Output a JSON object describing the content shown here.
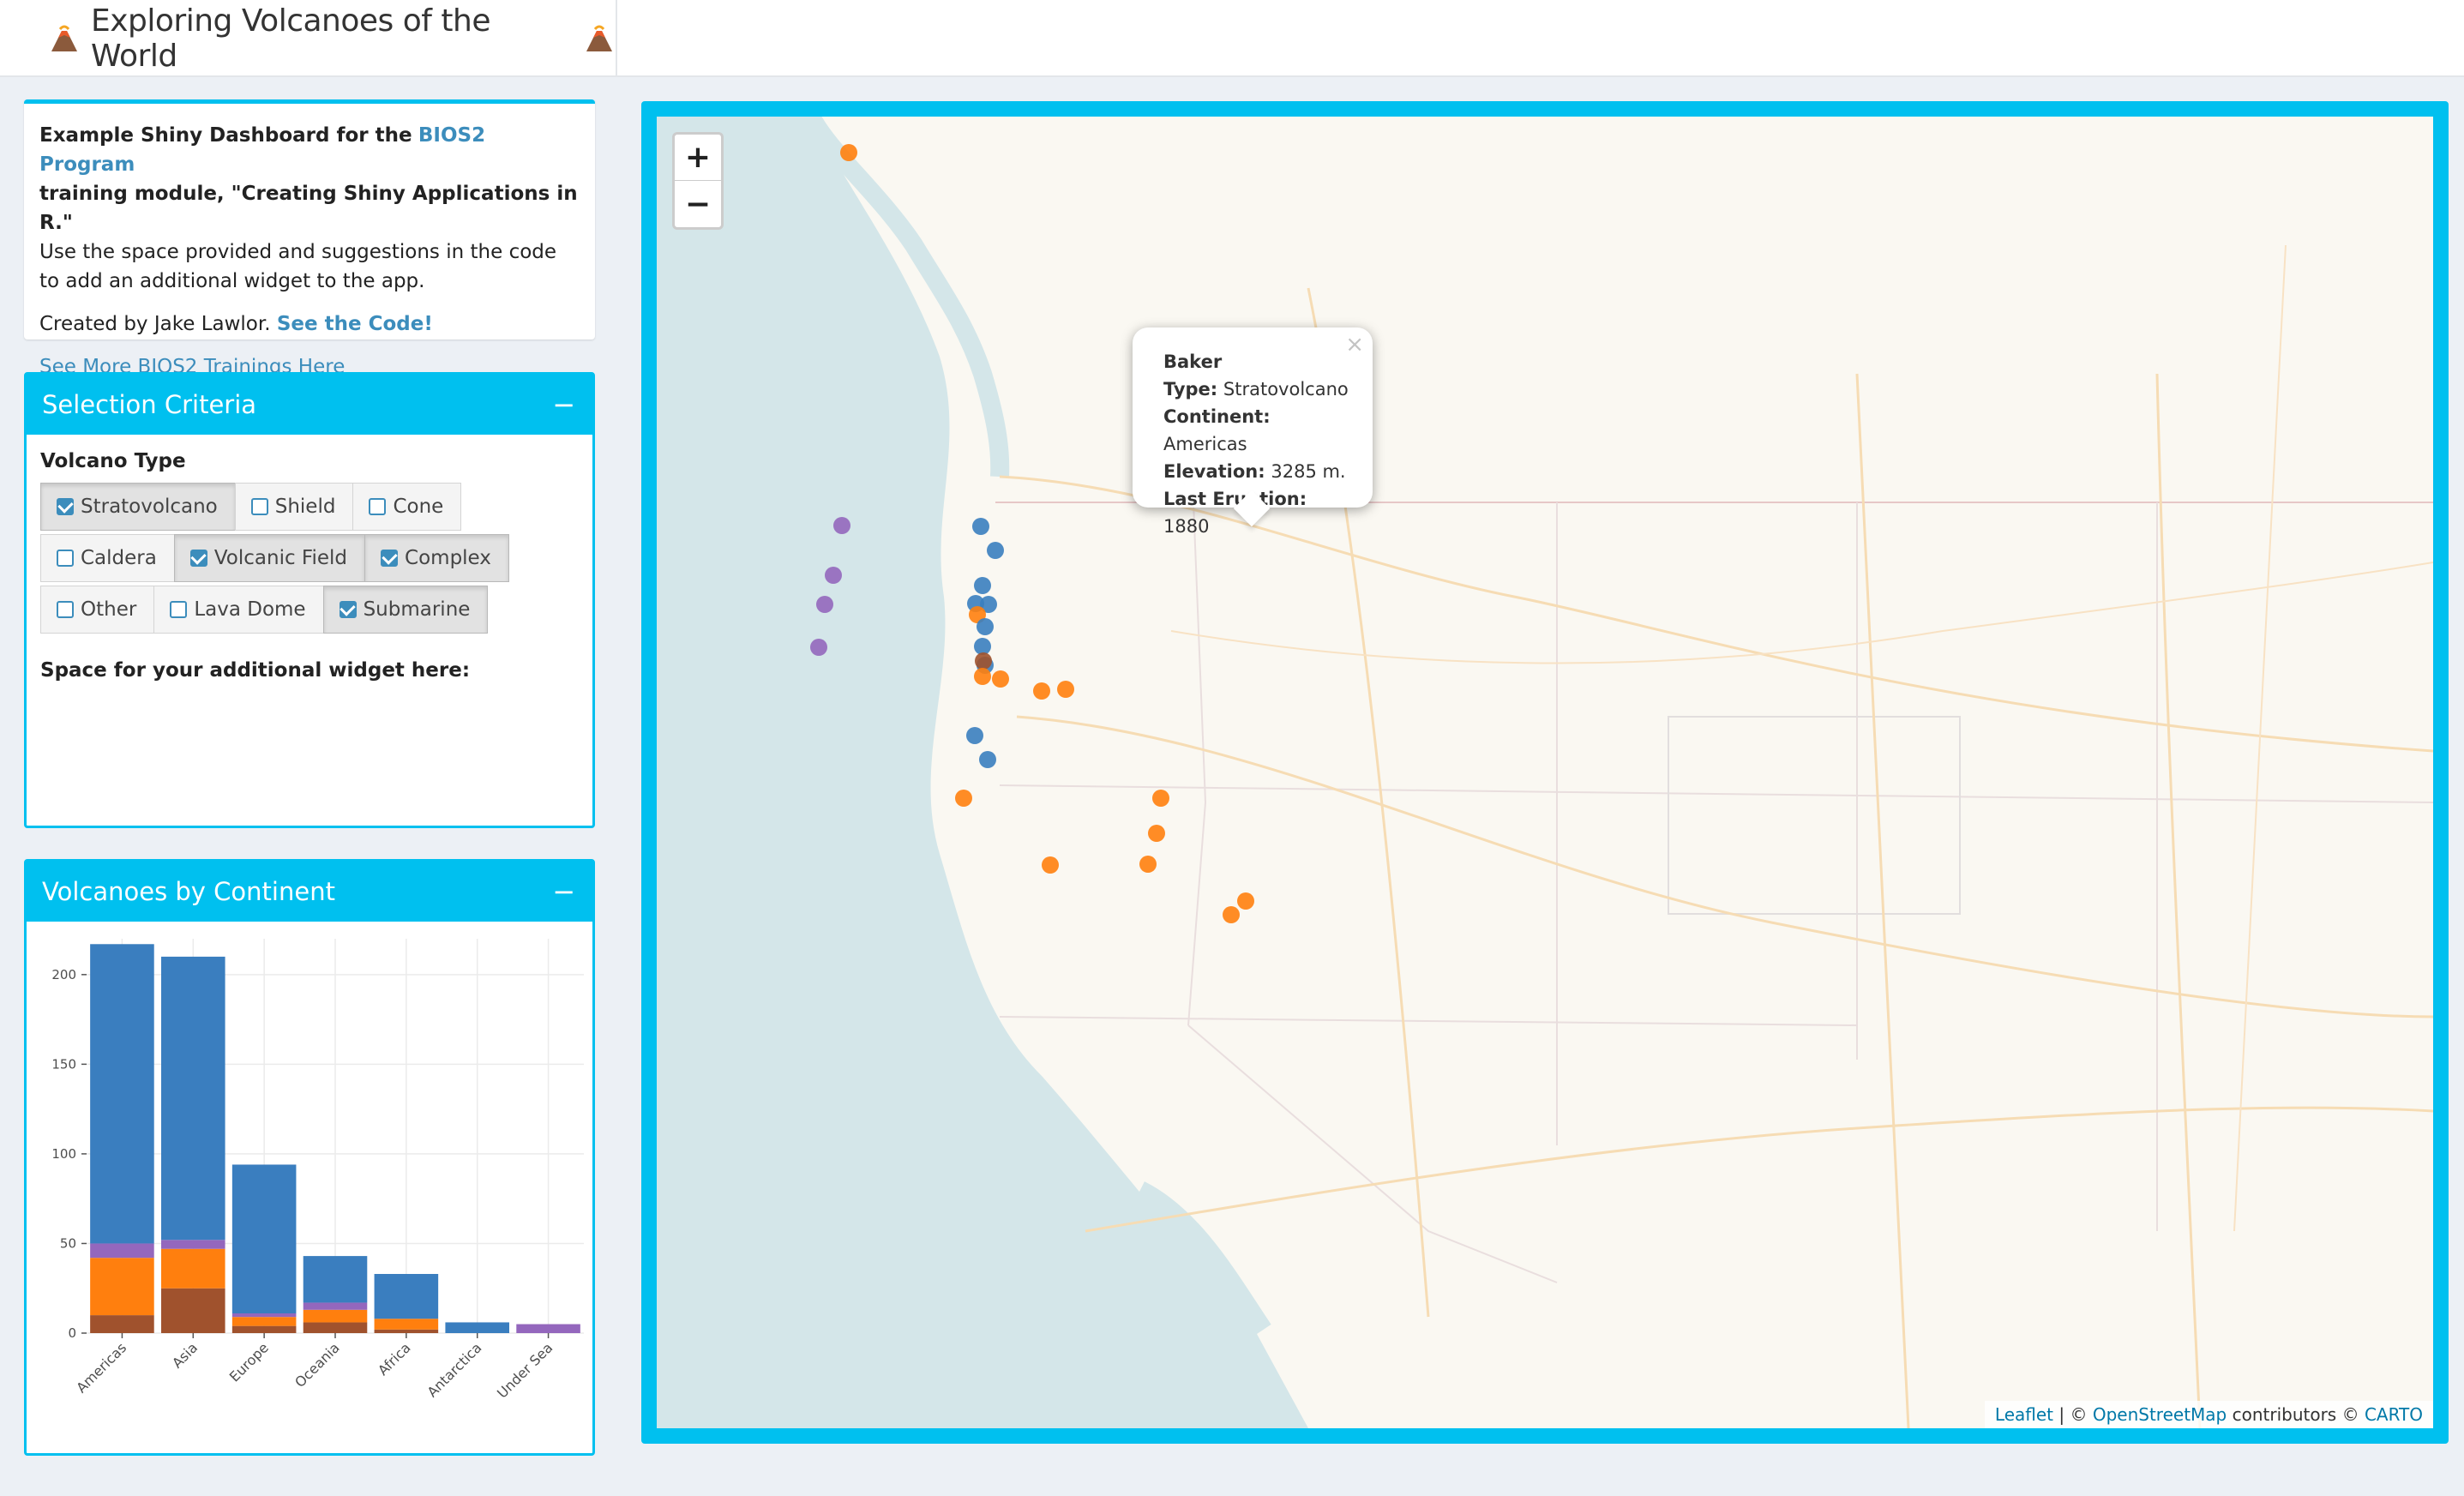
{
  "header": {
    "title": "Exploring Volcanoes of the World"
  },
  "info": {
    "intro_bold_1": "Example Shiny Dashboard for the",
    "intro_link": "BIOS2 Program",
    "intro_bold_2": "training module, \"Creating Shiny Applications in R.\"",
    "intro_text": "Use the space provided and suggestions in the code to add an additional widget to the app.",
    "created_by": "Created by Jake Lawlor.",
    "code_link": "See the Code!",
    "more_link": "See More BIOS2 Trainings Here"
  },
  "selection": {
    "title": "Selection Criteria",
    "collapse": "−",
    "type_label": "Volcano Type",
    "options": [
      {
        "label": "Stratovolcano",
        "checked": true
      },
      {
        "label": "Shield",
        "checked": false
      },
      {
        "label": "Cone",
        "checked": false
      },
      {
        "label": "Caldera",
        "checked": false
      },
      {
        "label": "Volcanic Field",
        "checked": true
      },
      {
        "label": "Complex",
        "checked": true
      },
      {
        "label": "Other",
        "checked": false
      },
      {
        "label": "Lava Dome",
        "checked": false
      },
      {
        "label": "Submarine",
        "checked": true
      }
    ],
    "extra_label": "Space for your additional widget here:"
  },
  "continent_box": {
    "title": "Volcanoes by Continent",
    "collapse": "−"
  },
  "chart_data": {
    "type": "bar",
    "stacked": true,
    "categories": [
      "Americas",
      "Asia",
      "Europe",
      "Oceania",
      "Africa",
      "Antarctica",
      "Under Sea"
    ],
    "series": [
      {
        "color": "#a0522d",
        "values": [
          10,
          25,
          4,
          6,
          2,
          0,
          0
        ]
      },
      {
        "color": "#ff7f0e",
        "values": [
          32,
          22,
          5,
          7,
          6,
          0,
          0
        ]
      },
      {
        "color": "#9467bd",
        "values": [
          8,
          5,
          2,
          4,
          0,
          0,
          5
        ]
      },
      {
        "color": "#3a7ebf",
        "values": [
          167,
          158,
          83,
          26,
          25,
          6,
          0
        ]
      }
    ],
    "ylim": [
      0,
      220
    ],
    "yticks": [
      0,
      50,
      100,
      150,
      200
    ],
    "grid": true
  },
  "map": {
    "zoom_in": "+",
    "zoom_out": "−",
    "popup": {
      "name": "Baker",
      "type_label": "Type:",
      "type": "Stratovolcano",
      "continent_label": "Continent:",
      "continent": "Americas",
      "elevation_label": "Elevation:",
      "elevation": "3285 m.",
      "eruption_label": "Last Eruption:",
      "eruption": "1880",
      "close": "×"
    },
    "attribution": {
      "leaflet": "Leaflet",
      "sep": " | © ",
      "osm": "OpenStreetMap",
      "mid": " contributors © ",
      "carto": "CARTO"
    },
    "colors": {
      "strato": "#3a7ebf",
      "field": "#ff7f0e",
      "submarine": "#9467bd",
      "complex": "#a0522d"
    }
  }
}
